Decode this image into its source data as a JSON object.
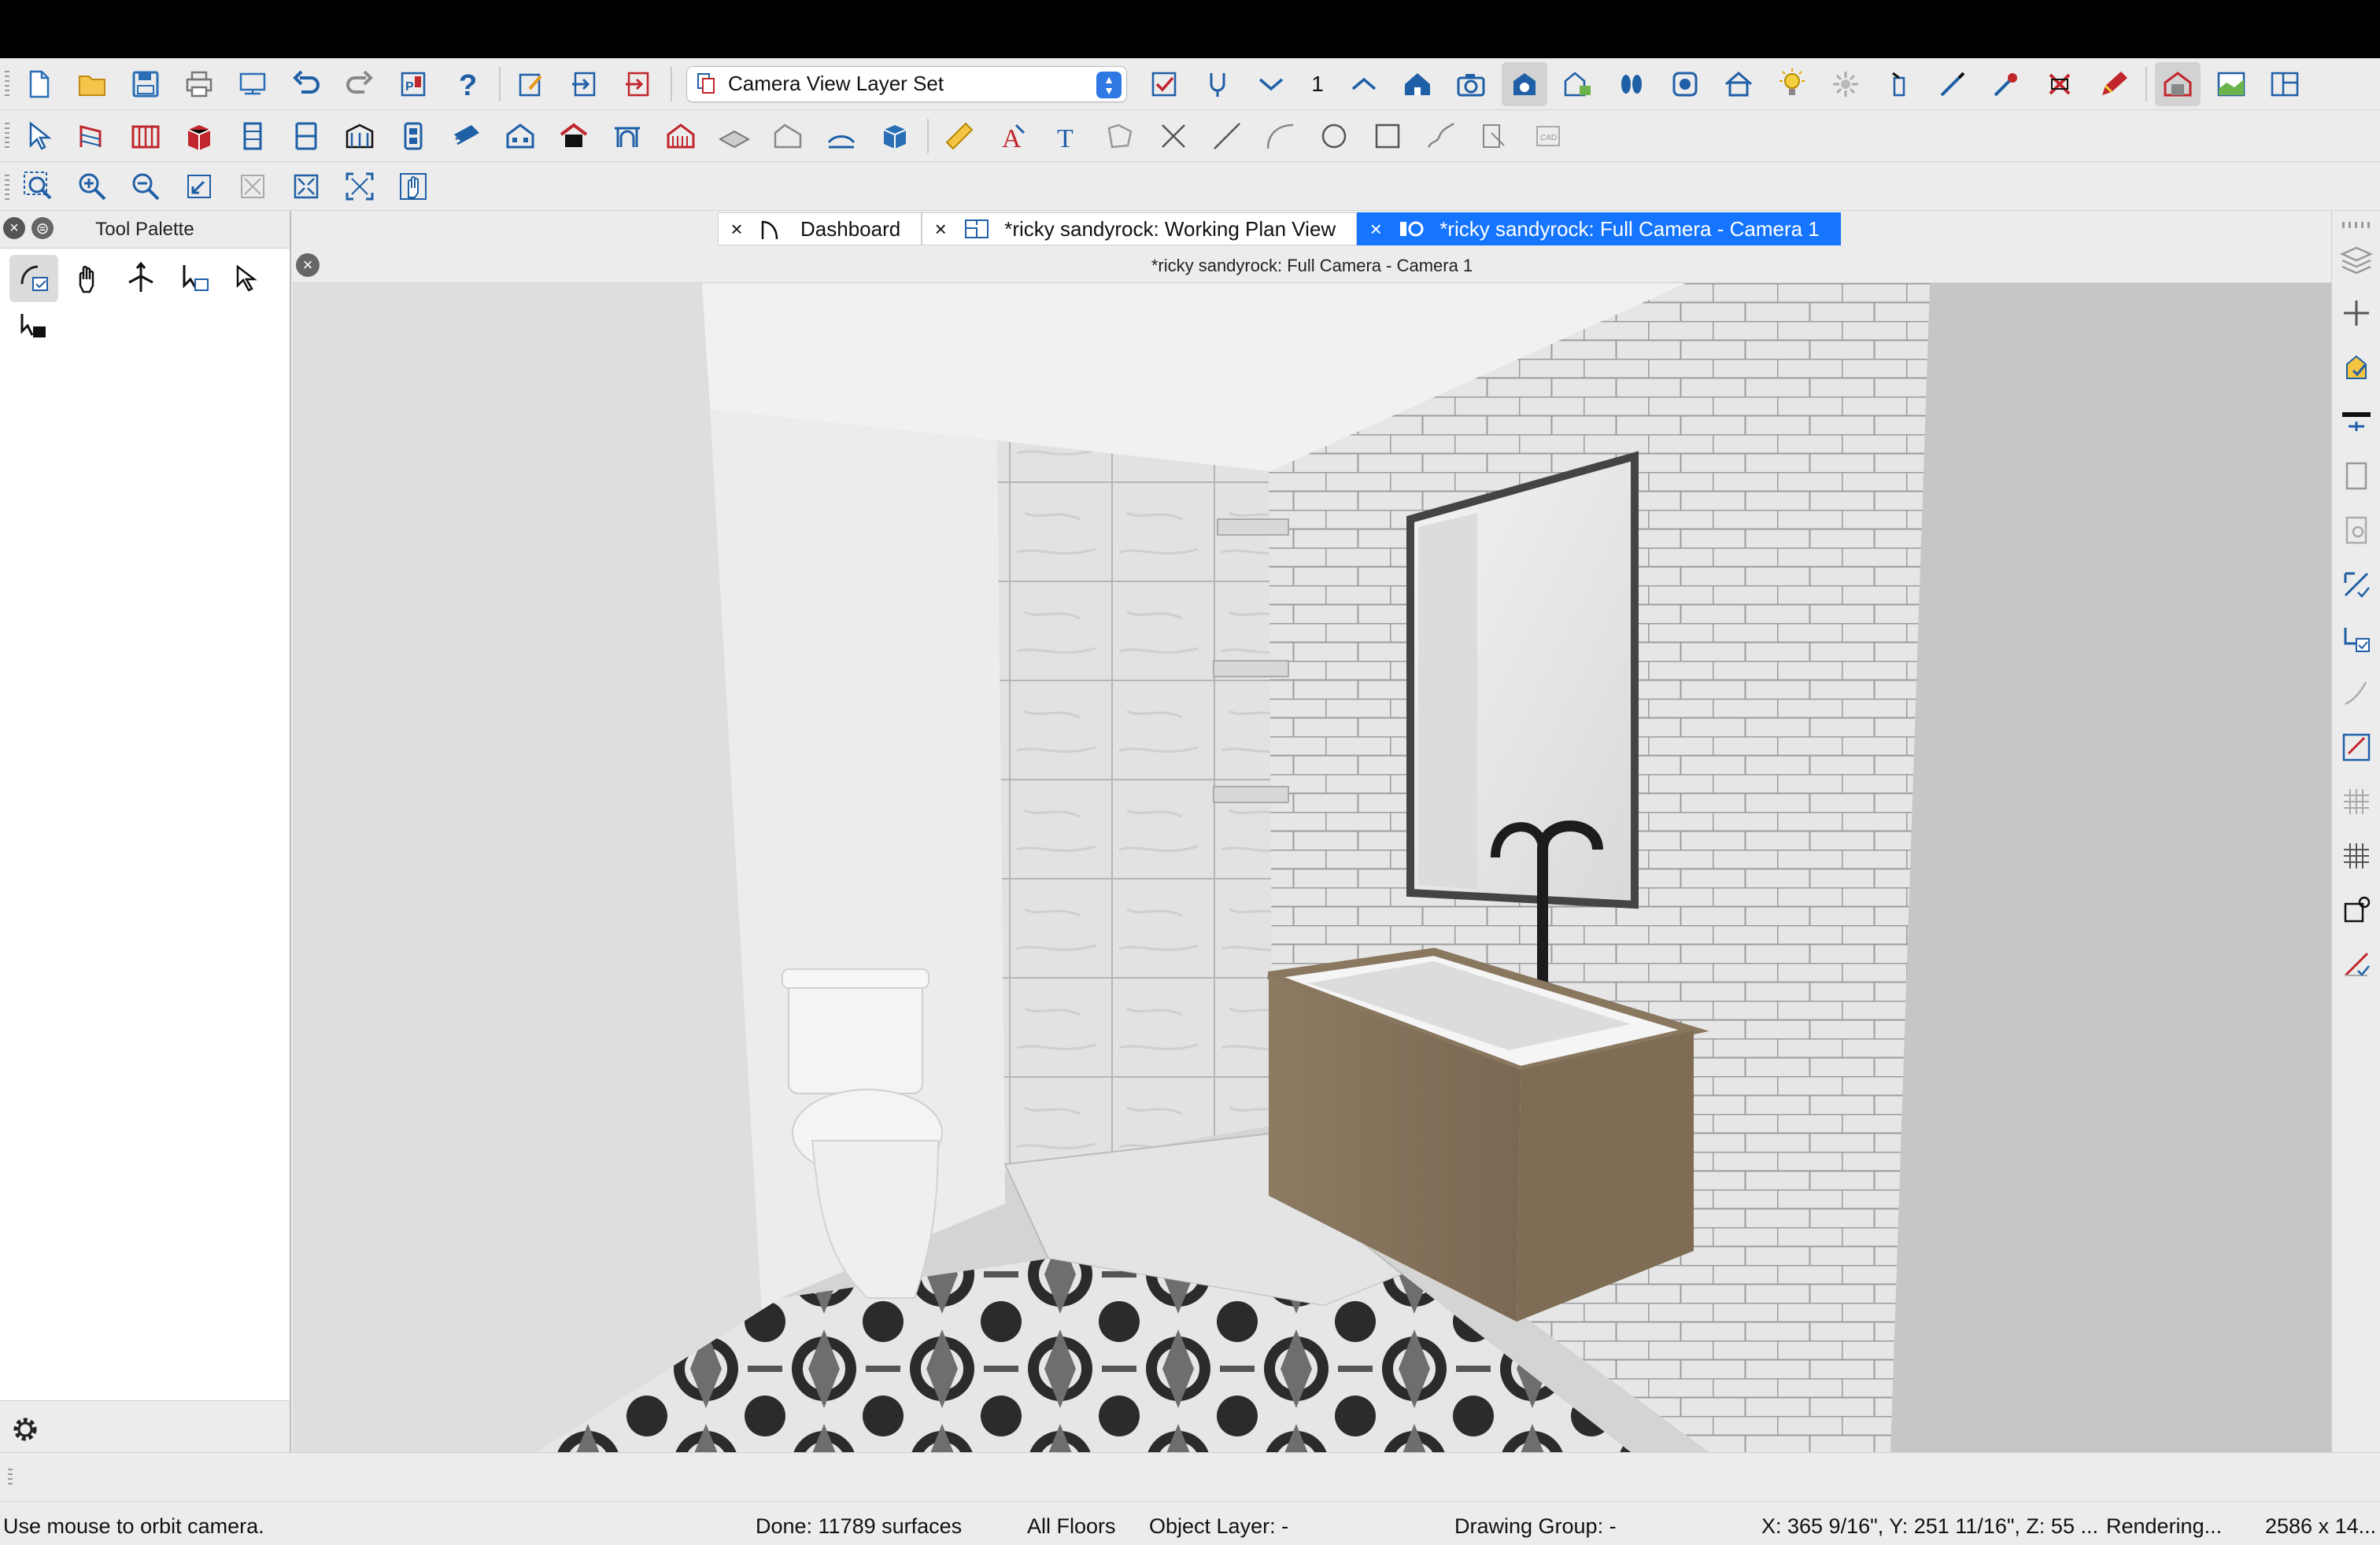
{
  "toolbar_top": {
    "layer_set": "Camera View Layer Set",
    "floor_number": "1",
    "icons": [
      "new-file-icon",
      "open-folder-icon",
      "save-icon",
      "print-icon",
      "print-preview-icon",
      "undo-icon",
      "redo-icon",
      "pdf-export-icon",
      "help-icon",
      "edit-check-icon",
      "send-to-layout-icon",
      "layout-page-icon"
    ],
    "icons_right": [
      "checklist-icon",
      "plumbing-icon",
      "chevron-down-icon",
      "chevron-up-icon",
      "house-icon",
      "camera-icon",
      "full-camera-icon",
      "elevation-icon",
      "walkthrough-icon",
      "render-icon",
      "building-icon",
      "light-icon",
      "sun-icon",
      "tool-icon",
      "wand-icon",
      "paint-brush-icon",
      "delete-icon",
      "pencil-icon",
      "camera-view-icon",
      "plan-view-icon",
      "layout-view-icon"
    ]
  },
  "toolbar_mid": {
    "icons": [
      "select-icon",
      "wall-tool-icon",
      "railing-icon",
      "cabinet-icon",
      "door-icon",
      "window-icon",
      "stairs-icon",
      "furniture-icon",
      "roof-icon",
      "building-icon",
      "home-icon",
      "arch-icon",
      "fence-icon",
      "floor-plane-icon",
      "terrain-icon",
      "curve-wall-icon",
      "cube-icon",
      "dimension-icon",
      "text-arrow-icon",
      "text-icon",
      "polyline-icon",
      "cross-icon",
      "line-icon",
      "arc-icon",
      "circle-icon",
      "rectangle-icon",
      "spline-icon",
      "picture-icon",
      "cad-icon"
    ]
  },
  "toolbar_view": {
    "icons": [
      "zoom-window-icon",
      "zoom-in-icon",
      "zoom-out-icon",
      "undo-zoom-icon",
      "fill-window-icon",
      "fill-plan-icon",
      "fit-icon",
      "pan-icon"
    ]
  },
  "palette": {
    "title": "Tool Palette",
    "tools": [
      "orbit-camera-icon",
      "pan-hand-icon",
      "move-camera-icon",
      "rotate-camera-icon",
      "select-object-icon",
      "camera-select-icon"
    ]
  },
  "tabs": [
    {
      "label": "Dashboard",
      "icon": "dashboard-icon",
      "active": false
    },
    {
      "label": "*ricky sandyrock:  Working Plan View",
      "icon": "plan-icon",
      "active": false
    },
    {
      "label": "*ricky sandyrock: Full Camera - Camera 1",
      "icon": "camera-tab-icon",
      "active": true
    }
  ],
  "document_title": "*ricky sandyrock: Full Camera - Camera 1",
  "status": {
    "hint": "Use mouse to orbit camera.",
    "surfaces": "Done:  11789 surfaces",
    "floors": "All Floors",
    "object_layer": "Object Layer: -",
    "drawing_group": "Drawing Group: -",
    "coords": "X: 365 9/16\", Y: 251 11/16\", Z: 55 ...",
    "rendering": "Rendering...",
    "size": "2586 x 14..."
  },
  "colors": {
    "accent": "#1675ff",
    "icon_blue": "#1f5fa6",
    "icon_red": "#c0262c"
  }
}
